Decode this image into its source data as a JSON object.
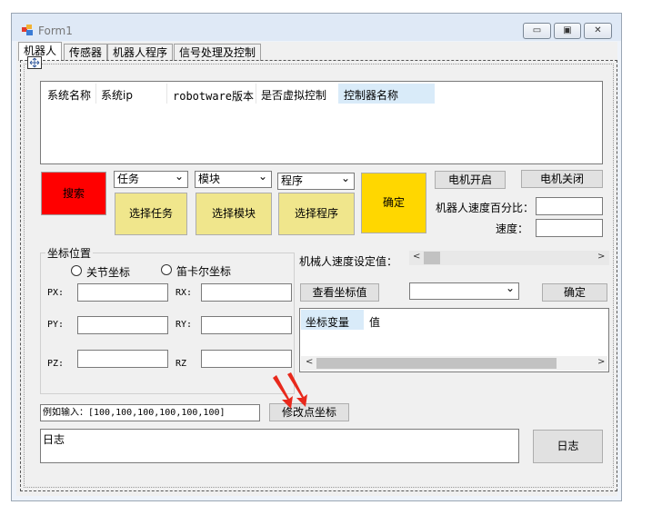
{
  "window": {
    "title": "Form1",
    "min": "▭",
    "max": "▣",
    "close": "✕"
  },
  "tabs": [
    "机器人",
    "传感器",
    "机器人程序",
    "信号处理及控制"
  ],
  "listview": {
    "columns": [
      "系统名称",
      "系统ip",
      "robotware版本",
      "是否虚拟控制",
      "控制器名称"
    ]
  },
  "buttons": {
    "search": "搜索",
    "select_task": "选择任务",
    "select_module": "选择模块",
    "select_program": "选择程序",
    "confirm_big": "确定",
    "motor_on": "电机开启",
    "motor_off": "电机关闭",
    "view_coord": "查看坐标值",
    "confirm_small": "确定",
    "modify_point": "修改点坐标",
    "log_button": "日志"
  },
  "combos": {
    "task": "任务",
    "module": "模块",
    "program": "程序",
    "coord_select": ""
  },
  "labels": {
    "speed_percent": "机器人速度百分比：",
    "speed": "速度：",
    "mech_speed_set": "机械人速度设定值：",
    "coord_group": "坐标位置",
    "joint": "关节坐标",
    "cartesian": "笛卡尔坐标",
    "px": "PX:",
    "py": "PY:",
    "pz": "PZ:",
    "rx": "RX:",
    "ry": "RY:",
    "rz": "RZ"
  },
  "coord_grid": {
    "columns": [
      "坐标变量",
      "值"
    ]
  },
  "inputs": {
    "example_input": "例如输入：[100,100,100,100,100,100]",
    "log_text": "日志"
  },
  "colors": {
    "search_bg": "#ff0000",
    "confirm_bg": "#ffd700",
    "select_bg": "#f0e68c"
  }
}
